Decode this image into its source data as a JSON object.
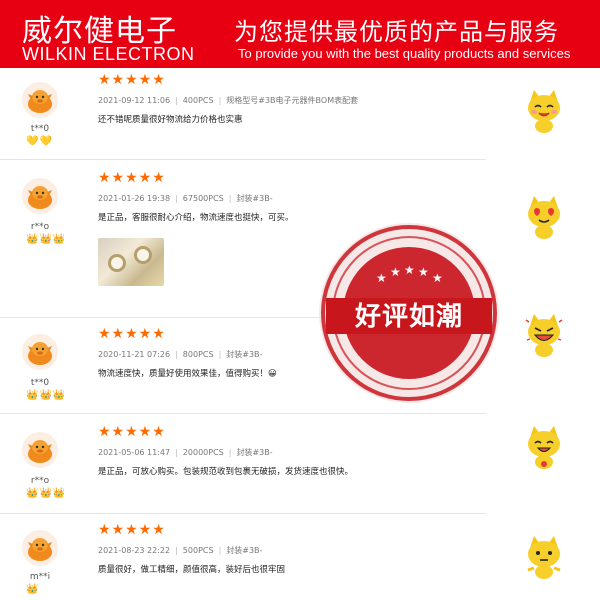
{
  "header": {
    "brand_cn": "威尔健电子",
    "brand_en": "WILKIN ELECTRON",
    "slogan_cn": "为您提供最优质的产品与服务",
    "slogan_en": "To provide you with the best quality products and services"
  },
  "stamp": {
    "text": "好评如潮"
  },
  "reviews": [
    {
      "user": "t**0",
      "stars": "★★★★★",
      "date": "2021-09-12 11:06",
      "qty": "400PCS",
      "spec": "规格型号#3B电子元器件BOM表配套",
      "text": "还不错呢质量很好物流给力价格也实惠",
      "badges": "💛💛"
    },
    {
      "user": "r**o",
      "stars": "★★★★★",
      "date": "2021-01-26 19:38",
      "qty": "67500PCS",
      "spec": "封装#3B-",
      "text": "是正品，客服很耐心介绍，物流速度也挺快，可买。",
      "badges": "👑👑👑"
    },
    {
      "user": "t**0",
      "stars": "★★★★★",
      "date": "2020-11-21 07:26",
      "qty": "800PCS",
      "spec": "封装#3B-",
      "text": "物流速度快，质量好使用效果佳，值得购买！😀",
      "badges": "👑👑👑"
    },
    {
      "user": "r**o",
      "stars": "★★★★★",
      "date": "2021-05-06 11:47",
      "qty": "20000PCS",
      "spec": "封装#3B-",
      "text": "是正品，可放心购买。包装规范收到包裹无破损，发货速度也很快。",
      "badges": "👑👑👑"
    },
    {
      "user": "m**i",
      "stars": "★★★★★",
      "date": "2021-08-23 22:22",
      "qty": "500PCS",
      "spec": "封装#3B-",
      "text": "质量很好，做工精细，颜值很高，装好后也很牢固",
      "badges": "👑"
    }
  ]
}
